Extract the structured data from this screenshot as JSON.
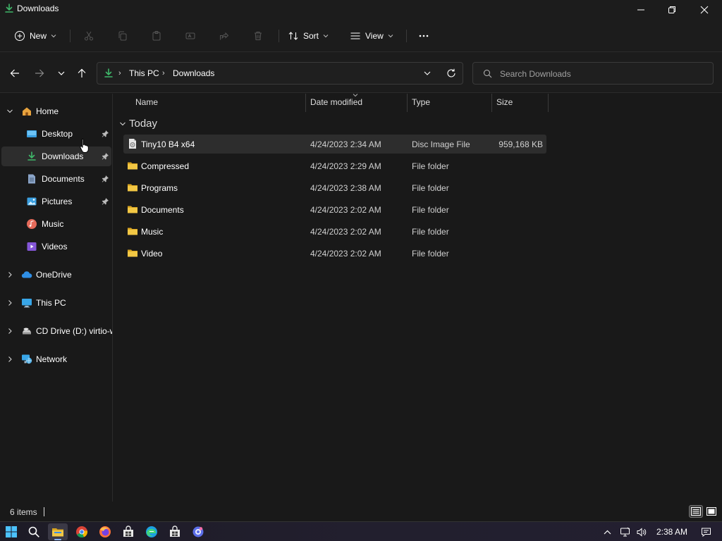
{
  "window": {
    "title": "Downloads",
    "minimize_icon": "minimize-icon",
    "maximize_icon": "restore-icon",
    "close_icon": "close-icon"
  },
  "toolbar": {
    "new_label": "New",
    "sort_label": "Sort",
    "view_label": "View",
    "icons": [
      "cut-icon",
      "copy-icon",
      "paste-icon",
      "rename-icon",
      "share-icon",
      "delete-icon",
      "more-icon"
    ]
  },
  "address_bar": {
    "crumbs": [
      "This PC",
      "Downloads"
    ],
    "search_placeholder": "Search Downloads"
  },
  "sidebar": {
    "items": [
      {
        "label": "Home",
        "icon": "home-icon",
        "expanded": true
      },
      {
        "label": "Desktop",
        "icon": "desktop-icon",
        "pinned": true
      },
      {
        "label": "Downloads",
        "icon": "download-icon",
        "pinned": true,
        "selected": true
      },
      {
        "label": "Documents",
        "icon": "documents-icon",
        "pinned": true
      },
      {
        "label": "Pictures",
        "icon": "pictures-icon",
        "pinned": true
      },
      {
        "label": "Music",
        "icon": "music-icon"
      },
      {
        "label": "Videos",
        "icon": "videos-icon"
      },
      {
        "label": "OneDrive",
        "icon": "cloud-icon",
        "expandable": true
      },
      {
        "label": "This PC",
        "icon": "monitor-icon",
        "expandable": true
      },
      {
        "label": "CD Drive (D:) virtio-w",
        "icon": "cd-drive-icon",
        "expandable": true
      },
      {
        "label": "Network",
        "icon": "network-icon",
        "expandable": true
      }
    ]
  },
  "file_list": {
    "columns": [
      "Name",
      "Date modified",
      "Type",
      "Size"
    ],
    "group_label": "Today",
    "rows": [
      {
        "name": "Tiny10 B4 x64",
        "date": "4/24/2023 2:34 AM",
        "type": "Disc Image File",
        "size": "959,168 KB",
        "icon": "disc-image-icon",
        "selected": true
      },
      {
        "name": "Compressed",
        "date": "4/24/2023 2:29 AM",
        "type": "File folder",
        "size": "",
        "icon": "folder-icon"
      },
      {
        "name": "Programs",
        "date": "4/24/2023 2:38 AM",
        "type": "File folder",
        "size": "",
        "icon": "folder-icon"
      },
      {
        "name": "Documents",
        "date": "4/24/2023 2:02 AM",
        "type": "File folder",
        "size": "",
        "icon": "folder-icon"
      },
      {
        "name": "Music",
        "date": "4/24/2023 2:02 AM",
        "type": "File folder",
        "size": "",
        "icon": "folder-icon"
      },
      {
        "name": "Video",
        "date": "4/24/2023 2:02 AM",
        "type": "File folder",
        "size": "",
        "icon": "folder-icon"
      }
    ]
  },
  "status_bar": {
    "item_count": "6 items"
  },
  "taskbar": {
    "time": "2:38 AM",
    "apps": [
      "start-icon",
      "search-icon",
      "file-explorer-icon",
      "chrome-icon",
      "firefox-icon",
      "store-icon",
      "edge-icon",
      "store-icon",
      "settings-icon"
    ]
  },
  "colors": {
    "background": "#191919",
    "accent_green": "#3fb86a",
    "folder_yellow": "#f2c744",
    "selection": "#2d2d2d"
  }
}
